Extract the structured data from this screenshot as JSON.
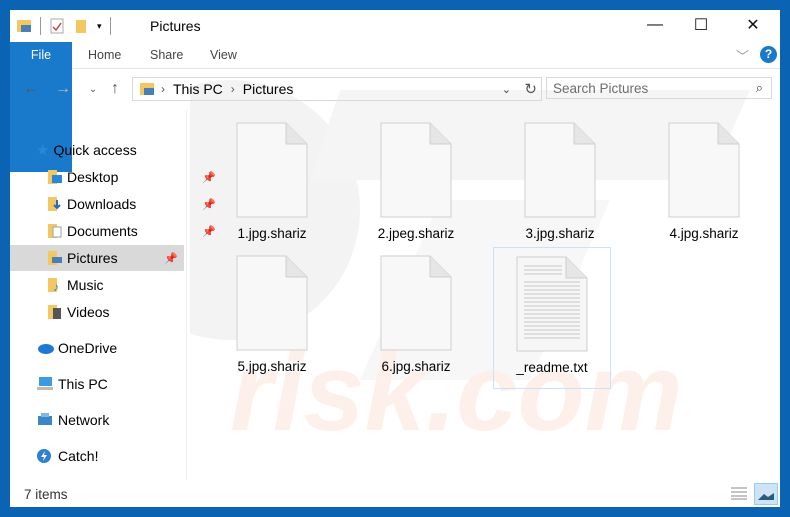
{
  "window": {
    "title": "Pictures",
    "minimize_label": "—",
    "maximize_label": "☐",
    "close_label": "✕"
  },
  "ribbon": {
    "tabs": [
      {
        "label": "File"
      },
      {
        "label": "Home"
      },
      {
        "label": "Share"
      },
      {
        "label": "View"
      }
    ],
    "help_label": "?"
  },
  "address": {
    "segments": [
      "This PC",
      "Pictures"
    ],
    "separator": "›"
  },
  "search": {
    "placeholder": "Search Pictures"
  },
  "nav": {
    "quick_access": "Quick access",
    "items": [
      {
        "label": "Desktop",
        "pinned": true
      },
      {
        "label": "Downloads",
        "pinned": true
      },
      {
        "label": "Documents",
        "pinned": true
      },
      {
        "label": "Pictures",
        "pinned": true,
        "selected": true
      },
      {
        "label": "Music",
        "pinned": false
      },
      {
        "label": "Videos",
        "pinned": false
      }
    ],
    "roots": [
      {
        "label": "OneDrive"
      },
      {
        "label": "This PC"
      },
      {
        "label": "Network"
      },
      {
        "label": "Catch!"
      }
    ]
  },
  "files": [
    {
      "name": "1.jpg.shariz"
    },
    {
      "name": "2.jpeg.shariz"
    },
    {
      "name": "3.jpg.shariz"
    },
    {
      "name": "4.jpg.shariz"
    },
    {
      "name": "5.jpg.shariz"
    },
    {
      "name": "6.jpg.shariz"
    },
    {
      "name": "_readme.txt",
      "selected": true
    }
  ],
  "status": {
    "count_text": "7 items"
  },
  "colors": {
    "accent": "#1979ca",
    "frame": "#0b63b3"
  }
}
